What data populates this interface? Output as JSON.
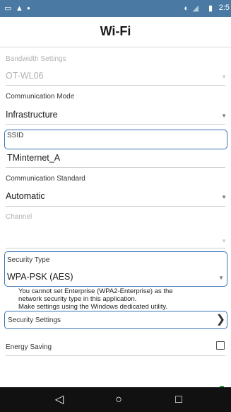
{
  "statusbar": {
    "time": "2:5",
    "icons": [
      "image-icon",
      "cloud-upload-icon",
      "notification-icon",
      "data-transfer-icon",
      "wifi-signal-icon",
      "battery-icon"
    ]
  },
  "appbar": {
    "title": "Wi-Fi"
  },
  "settings": {
    "bandwidth": {
      "label": "Bandwidth Settings",
      "value": "OT-WL06"
    },
    "comm_mode": {
      "label": "Communication Mode",
      "value": "Infrastructure"
    },
    "ssid": {
      "label": "SSID",
      "value": "TMinternet_A"
    },
    "comm_standard": {
      "label": "Communication Standard",
      "value": "Automatic"
    },
    "channel": {
      "label": "Channel",
      "value": ""
    },
    "security_type": {
      "label": "Security Type",
      "value": "WPA-PSK (AES)"
    },
    "note_lines": [
      "You cannot set Enterprise (WPA2-Enterprise) as the",
      "network security type in this application.",
      "Make settings using the Windows dedicated utility."
    ],
    "security_settings": {
      "label": "Security Settings"
    },
    "energy_saving": {
      "label": "Energy Saving",
      "checked": false
    }
  },
  "navbar": {
    "back": "◁",
    "home": "○",
    "recents": "□"
  }
}
